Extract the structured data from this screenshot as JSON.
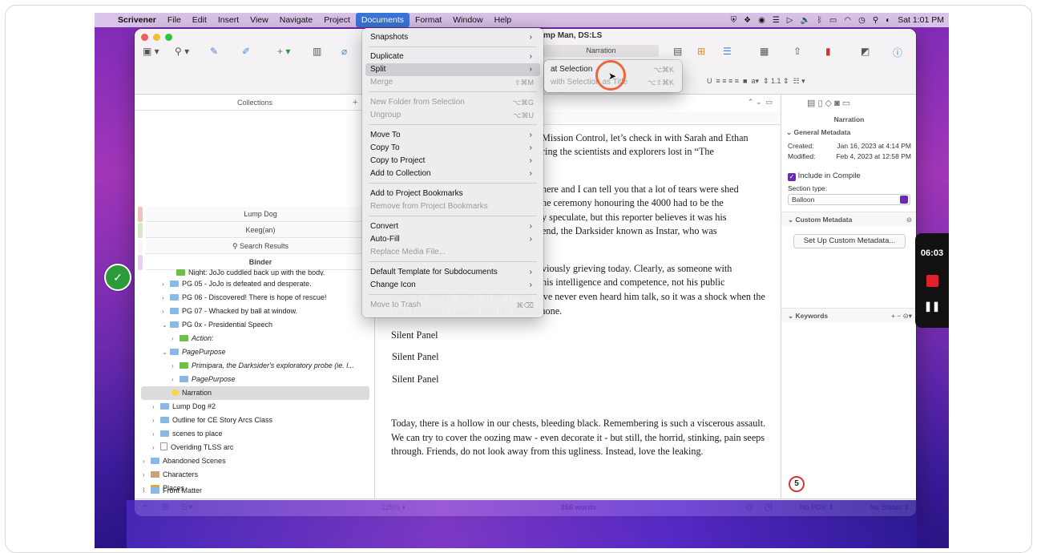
{
  "menubar": {
    "app_name": "Scrivener",
    "items": [
      "File",
      "Edit",
      "Insert",
      "View",
      "Navigate",
      "Project",
      "Documents",
      "Format",
      "Window",
      "Help"
    ],
    "clock": "Sat 1:01 PM"
  },
  "window": {
    "title": "mp Man, DS:LS",
    "header_label": "Narration"
  },
  "collections": {
    "header": "Collections",
    "tabs": [
      "Lump Dog",
      "Keeg(an)",
      "Search Results",
      "Binder"
    ]
  },
  "binder": {
    "rows": [
      {
        "label": "Night: JoJo cuddled back up with the body.",
        "italic": false
      },
      {
        "label": "PG 05 -  JoJo is defeated and desperate.",
        "italic": false
      },
      {
        "label": "PG 06 - Discovered! There is hope of rescue!",
        "italic": false
      },
      {
        "label": "PG 07 - Whacked by ball at window.",
        "italic": false
      },
      {
        "label": "PG 0x - Presidential Speech",
        "italic": false
      },
      {
        "label": "Action:",
        "italic": true
      },
      {
        "label": "PagePurpose",
        "italic": true
      },
      {
        "label": "Primipara, the Darksider's exploratory probe (ie. l...",
        "italic": true
      },
      {
        "label": "PagePurpose",
        "italic": true
      },
      {
        "label": "Narration",
        "italic": false
      },
      {
        "label": "Lump Dog #2",
        "italic": false
      },
      {
        "label": "Outline for CE Story Arcs Class",
        "italic": false
      },
      {
        "label": "scenes to place",
        "italic": false
      },
      {
        "label": "Overiding TLSS arc",
        "italic": false
      },
      {
        "label": "Abandoned Scenes",
        "italic": false
      },
      {
        "label": "Characters",
        "italic": false
      },
      {
        "label": "Places",
        "italic": false
      },
      {
        "label": "Front Matter",
        "italic": false
      }
    ]
  },
  "documents_menu": {
    "items": [
      {
        "label": "Snapshots",
        "shortcut": "",
        "submenu": true,
        "disabled": false
      },
      {
        "label": "Duplicate",
        "shortcut": "",
        "submenu": true,
        "disabled": false
      },
      {
        "label": "Split",
        "shortcut": "",
        "submenu": true,
        "disabled": false
      },
      {
        "label": "Merge",
        "shortcut": "⇧⌘M",
        "submenu": false,
        "disabled": true
      },
      {
        "label": "New Folder from Selection",
        "shortcut": "⌥⌘G",
        "submenu": false,
        "disabled": true
      },
      {
        "label": "Ungroup",
        "shortcut": "⌥⌘U",
        "submenu": false,
        "disabled": true
      },
      {
        "label": "Move To",
        "shortcut": "",
        "submenu": true,
        "disabled": false
      },
      {
        "label": "Copy To",
        "shortcut": "",
        "submenu": true,
        "disabled": false
      },
      {
        "label": "Copy to Project",
        "shortcut": "",
        "submenu": true,
        "disabled": false
      },
      {
        "label": "Add to Collection",
        "shortcut": "",
        "submenu": true,
        "disabled": false
      },
      {
        "label": "Add to Project Bookmarks",
        "shortcut": "",
        "submenu": false,
        "disabled": false
      },
      {
        "label": "Remove from Project Bookmarks",
        "shortcut": "",
        "submenu": false,
        "disabled": true
      },
      {
        "label": "Convert",
        "shortcut": "",
        "submenu": true,
        "disabled": false
      },
      {
        "label": "Auto-Fill",
        "shortcut": "",
        "submenu": true,
        "disabled": false
      },
      {
        "label": "Replace Media File...",
        "shortcut": "",
        "submenu": false,
        "disabled": true
      },
      {
        "label": "Default Template for Subdocuments",
        "shortcut": "",
        "submenu": true,
        "disabled": false
      },
      {
        "label": "Change Icon",
        "shortcut": "",
        "submenu": true,
        "disabled": false
      },
      {
        "label": "Move to Trash",
        "shortcut": "⌘⌫",
        "submenu": false,
        "disabled": true
      }
    ]
  },
  "split_submenu": {
    "items": [
      {
        "label": "at Selection",
        "shortcut": "⌥⌘K",
        "disabled": false
      },
      {
        "label": "with Selection as Title",
        "shortcut": "⌥⇧⌘K",
        "disabled": true
      }
    ]
  },
  "editor": {
    "cropped_lines": [
      "Mission Control, let’s check in with Sarah and Ethan",
      "ring the scientists and explorers lost in “The",
      "here and I can tell you that a lot of tears were shed",
      "he ceremony honouring the 4000 had to be the",
      "y speculate, but this reporter believes it was his",
      "end, the Darksider known as Instar, who was",
      "viously grieving today. Clearly, as someone with",
      " his intelligence and competence, not his public"
    ],
    "para1_tail": "speaking ability. Many in the crowd have never even heard him talk, so it was a shock when the Vice President handed him the microphone.",
    "silent_panels": [
      "Silent Panel",
      "Silent Panel",
      "Silent Panel"
    ],
    "para_last": "Today, there is a hollow in our chests, bleeding black. Remembering is such a viscerous assault. We can try to cover the oozing maw - even decorate it - but still, the horrid, stinking, pain seeps through.  Friends, do not look away from this ugliness. Instead, love the leaking.",
    "zoom": "125%",
    "word_count": "266 words"
  },
  "inspector": {
    "title": "Narration",
    "general_metadata": "General Metadata",
    "created_label": "Created:",
    "created_value": "Jan 16, 2023 at 4:14 PM",
    "modified_label": "Modified:",
    "modified_value": "Feb 4, 2023 at 12:58 PM",
    "include_compile": "Include in Compile",
    "section_type_label": "Section type:",
    "section_type_value": "Balloon",
    "custom_metadata": "Custom Metadata",
    "setup_button": "Set Up Custom Metadata...",
    "keywords": "Keywords",
    "pov": "No POV",
    "status": "No Status"
  },
  "recorder": {
    "time": "06:03"
  },
  "badge": "5",
  "colors": {
    "menu_highlight": "#3a76d8",
    "record_red": "#e0202a",
    "cursor_ring": "#f0663a",
    "check_green": "#2c9a3a"
  }
}
